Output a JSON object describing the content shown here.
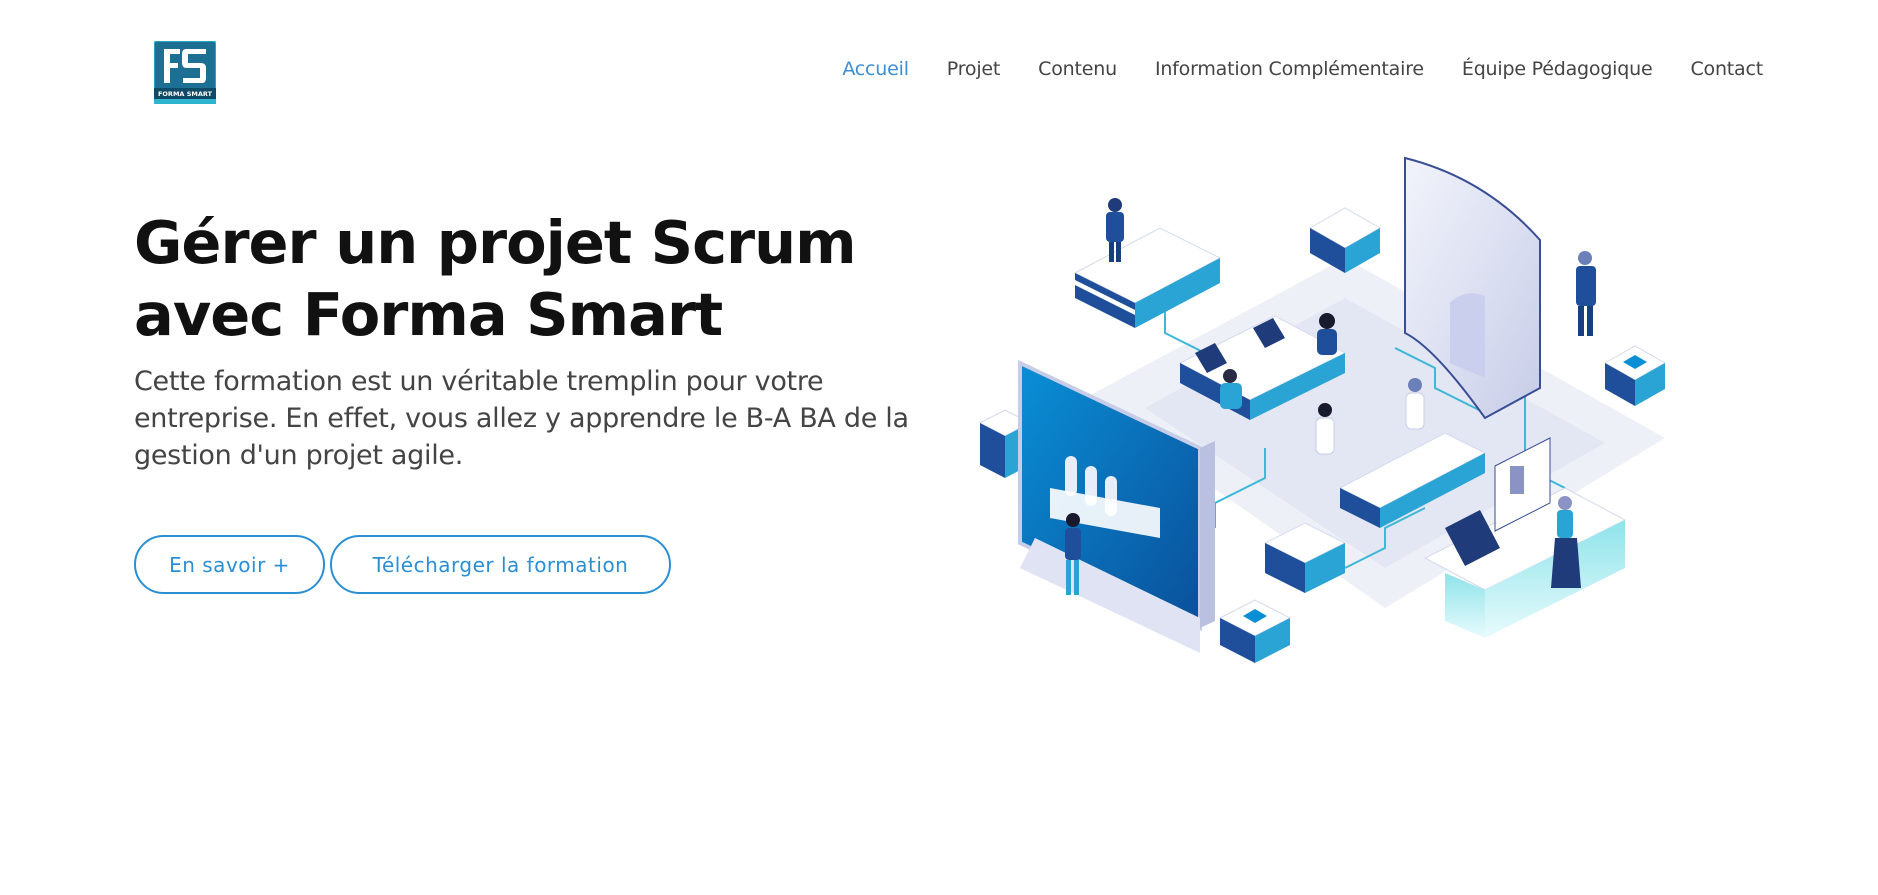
{
  "logo": {
    "initials": "FS",
    "caption": "FORMA SMART",
    "colors": {
      "primary": "#1d6f94",
      "accent": "#2fb4cf"
    }
  },
  "nav": {
    "items": [
      {
        "label": "Accueil",
        "active": true
      },
      {
        "label": "Projet"
      },
      {
        "label": "Contenu"
      },
      {
        "label": "Information Complémentaire"
      },
      {
        "label": "Équipe Pédagogique"
      },
      {
        "label": "Contact"
      }
    ],
    "active_color": "#3d8fd2"
  },
  "hero": {
    "title": "Gérer un projet Scrum avec Forma Smart",
    "description": "Cette formation est un véritable tremplin pour votre entreprise. En effet, vous allez y apprendre le B-A BA de la gestion d'un projet agile.",
    "primary_button": "En savoir +",
    "secondary_button": "Télécharger la formation",
    "button_color": "#2b8fd3"
  },
  "illustration": {
    "subject": "isometric office team illustration"
  }
}
